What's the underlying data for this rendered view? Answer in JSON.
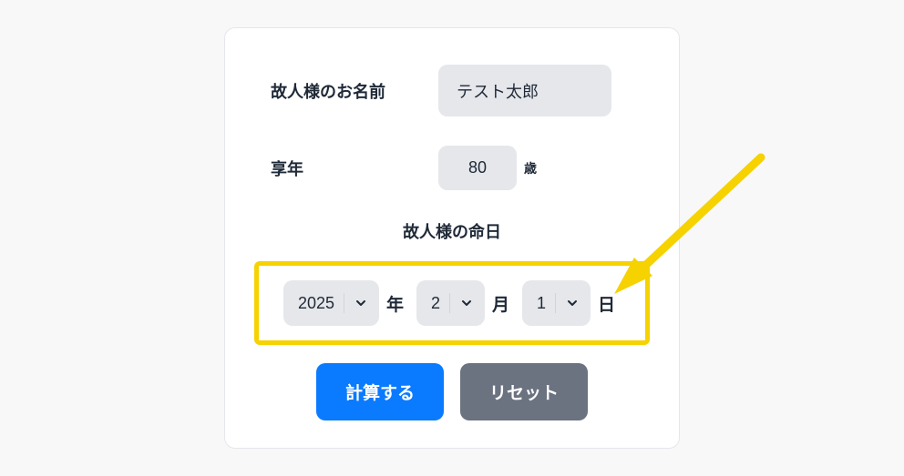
{
  "form": {
    "name_label": "故人様のお名前",
    "name_value": "テスト太郎",
    "age_label": "享年",
    "age_value": "80",
    "age_suffix": "歳",
    "date_section_label": "故人様の命日",
    "year_value": "2025",
    "year_suffix": "年",
    "month_value": "2",
    "month_suffix": "月",
    "day_value": "1",
    "day_suffix": "日"
  },
  "buttons": {
    "calculate": "計算する",
    "reset": "リセット"
  },
  "annotation": {
    "highlight_color": "#f5d200",
    "arrow_color": "#f5d200"
  }
}
